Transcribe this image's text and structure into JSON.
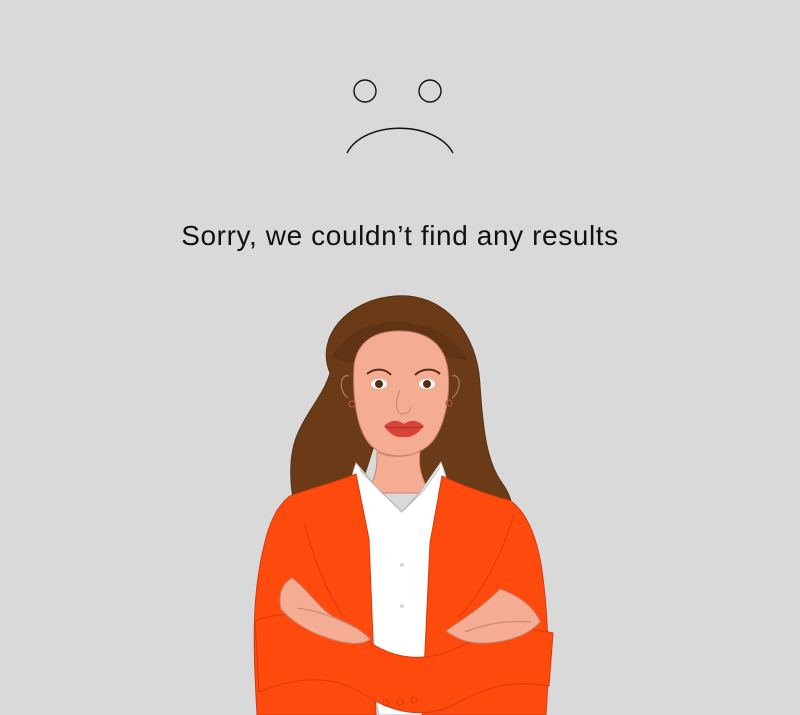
{
  "empty_state": {
    "icon": "sad-face-icon",
    "message": "Sorry, we couldn’t find any results",
    "illustration": "woman-arms-crossed-illustration"
  },
  "colors": {
    "background": "#d9d9d9",
    "text": "#111111",
    "hair": "#6b3a17",
    "skin": "#f4ad93",
    "jacket": "#ff4a0e",
    "shirt": "#ffffff",
    "lips": "#d94339"
  }
}
